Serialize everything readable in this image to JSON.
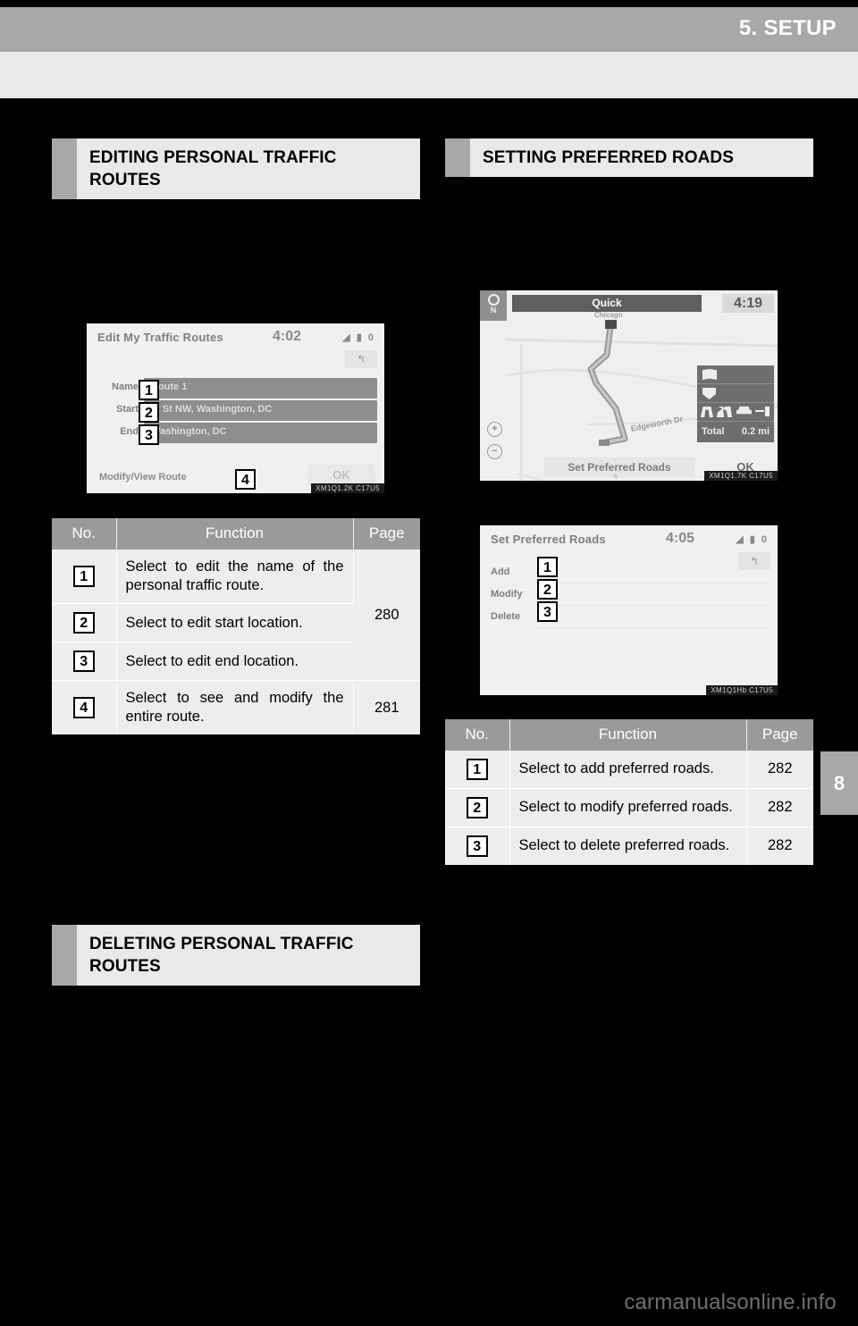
{
  "header": {
    "chapter": "5. SETUP",
    "side_tab": "8"
  },
  "left_column": {
    "heading_1": "EDITING PERSONAL TRAFFIC ROUTES",
    "screenshot": {
      "title": "Edit My Traffic Routes",
      "clock": "4:02",
      "status_icons": "◢ ▮ 0",
      "back_icon": "↰",
      "rows": [
        {
          "label": "Name",
          "value": "Route 1"
        },
        {
          "label": "Start",
          "value": "st St NW, Washington, DC"
        },
        {
          "label": "End",
          "value": "Washington, DC"
        }
      ],
      "bottom_label": "Modify/View Route",
      "ok_label": "OK",
      "watermark": "XM1Q1.2K C17U5",
      "callouts": [
        "1",
        "2",
        "3",
        "4"
      ]
    },
    "table": {
      "columns": [
        "No.",
        "Function",
        "Page"
      ],
      "rows": [
        {
          "no": "1",
          "function": "Select to edit the name of the personal traffic route.",
          "page": "280",
          "page_rowspan": 3
        },
        {
          "no": "2",
          "function": "Select to edit start location.",
          "page": "",
          "page_rowspan": 0
        },
        {
          "no": "3",
          "function": "Select to edit end location.",
          "page": "",
          "page_rowspan": 0
        },
        {
          "no": "4",
          "function": "Select to see and modify the entire route.",
          "page": "281",
          "page_rowspan": 1
        }
      ]
    },
    "heading_2": "DELETING PERSONAL TRAFFIC ROUTES"
  },
  "right_column": {
    "heading_1": "SETTING PREFERRED ROADS",
    "map_screenshot": {
      "compass_label": "N",
      "route_type": "Quick",
      "clock": "4:19",
      "destination_label": "Chicago",
      "street_label": "Edgeworth Dr",
      "zoom_in": "+",
      "zoom_out": "−",
      "total_label": "Total",
      "total_value": "0.2 mi",
      "set_preferred_roads_button": "Set Preferred Roads",
      "ok_button": "OK",
      "scale_text": "ft",
      "watermark": "XM1Q1.7K C17U5"
    },
    "screenshot": {
      "title": "Set Preferred Roads",
      "clock": "4:05",
      "status_icons": "◢ ▮ 0",
      "back_icon": "↰",
      "rows": [
        {
          "label": "Add"
        },
        {
          "label": "Modify"
        },
        {
          "label": "Delete"
        }
      ],
      "watermark": "XM1Q1Hb C17U5",
      "callouts": [
        "1",
        "2",
        "3"
      ]
    },
    "table": {
      "columns": [
        "No.",
        "Function",
        "Page"
      ],
      "rows": [
        {
          "no": "1",
          "function": "Select to add preferred roads.",
          "page": "282"
        },
        {
          "no": "2",
          "function": "Select to modify preferred roads.",
          "page": "282"
        },
        {
          "no": "3",
          "function": "Select to delete preferred roads.",
          "page": "282"
        }
      ]
    }
  },
  "footer": {
    "watermark": "carmanualsonline.info"
  }
}
